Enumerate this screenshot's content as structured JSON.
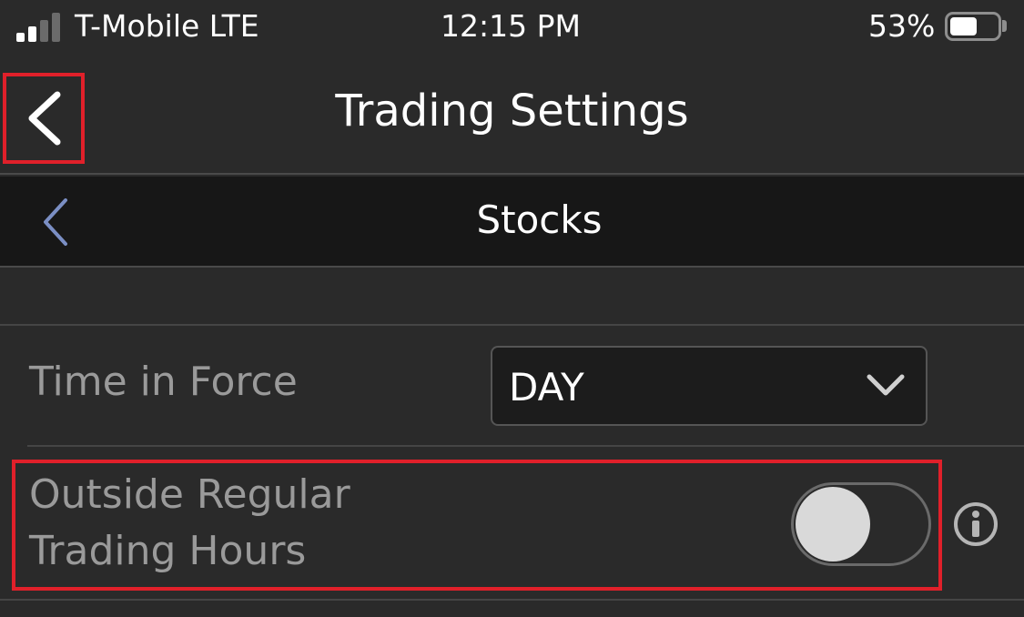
{
  "status_bar": {
    "carrier": "T-Mobile LTE",
    "time": "12:15 PM",
    "battery_percent": "53%",
    "battery_level": 0.53,
    "signal_bars": 2
  },
  "nav": {
    "title": "Trading Settings",
    "back_icon": "chevron-left-icon"
  },
  "section": {
    "title": "Stocks",
    "back_icon": "chevron-left-icon",
    "back_color": "#7b8fc4"
  },
  "settings": {
    "time_in_force": {
      "label": "Time in Force",
      "value": "DAY"
    },
    "outside_rth": {
      "label": "Outside Regular Trading Hours",
      "enabled": false,
      "info_icon": "info-icon"
    }
  },
  "colors": {
    "background": "#2a2a2a",
    "section_background": "#171717",
    "highlight": "#e0202a",
    "label_gray": "#9a9a9a"
  }
}
